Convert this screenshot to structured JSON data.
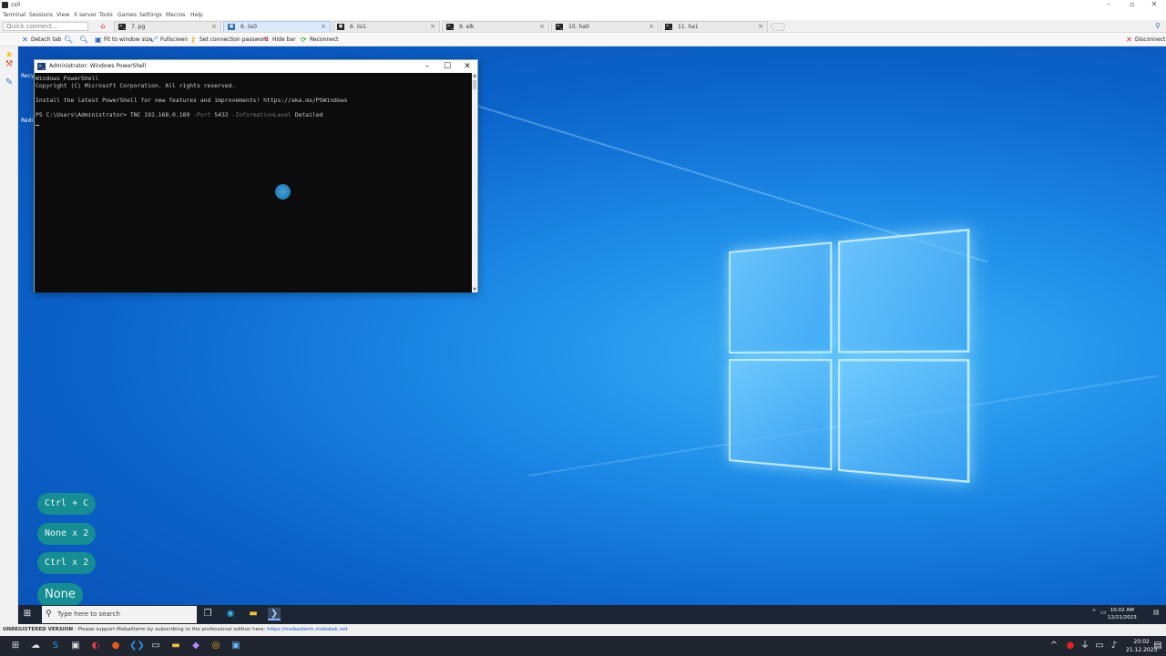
{
  "app": {
    "title": "cs0"
  },
  "menu": [
    "Terminal",
    "Sessions",
    "View",
    "X server",
    "Tools",
    "Games",
    "Settings",
    "Macros",
    "Help"
  ],
  "quick_connect": {
    "placeholder": "Quick connect..."
  },
  "tabs": [
    {
      "label": "7. pg",
      "active": false
    },
    {
      "label": "6. iis0",
      "active": true
    },
    {
      "label": "6. iis1",
      "active": false
    },
    {
      "label": "9. elk",
      "active": false
    },
    {
      "label": "10. ha0",
      "active": false
    },
    {
      "label": "11. ha1",
      "active": false
    }
  ],
  "toolbar": {
    "detach": "Detach tab",
    "fit": "Fit to window size",
    "fullscreen": "Fullscreen",
    "password": "Set connection password",
    "hide": "Hide bar",
    "reconnect": "Reconnect",
    "disconnect": "Disconnect"
  },
  "desktop_icons": {
    "recycle": "Recy",
    "red": "Redi"
  },
  "powershell": {
    "title": "Administrator: Windows PowerShell",
    "lines": {
      "l1": "Windows PowerShell",
      "l2": "Copyright (C) Microsoft Corporation. All rights reserved.",
      "l3": "Install the latest PowerShell for new features and improvements! https://aka.ms/PSWindows",
      "prompt": "PS C:\\Users\\Administrator> ",
      "cmd": "TNC 192.168.0.189 ",
      "p1": "-Port ",
      "v1": "5432 ",
      "p2": "-InformationLevel ",
      "v2": "Detailed"
    }
  },
  "keys": {
    "k1": "Ctrl + C",
    "k2": "None x 2",
    "k3": "Ctrl x 2",
    "k4": "None"
  },
  "taskbar": {
    "search_placeholder": "Type here to search",
    "time": "10:02 AM",
    "date": "12/21/2023"
  },
  "status": {
    "unreg": "UNREGISTERED VERSION",
    "msg": " -  Please support MobaXterm by subscribing to the professional edition here: ",
    "link": "https://mobaxterm.mobatek.net"
  },
  "host_clock": {
    "time": "20:02",
    "date": "21.12.2023"
  },
  "colors": {
    "desktop": "#0b62c9",
    "key_pill": "#168c93",
    "console_bg": "#0c0c0c"
  }
}
